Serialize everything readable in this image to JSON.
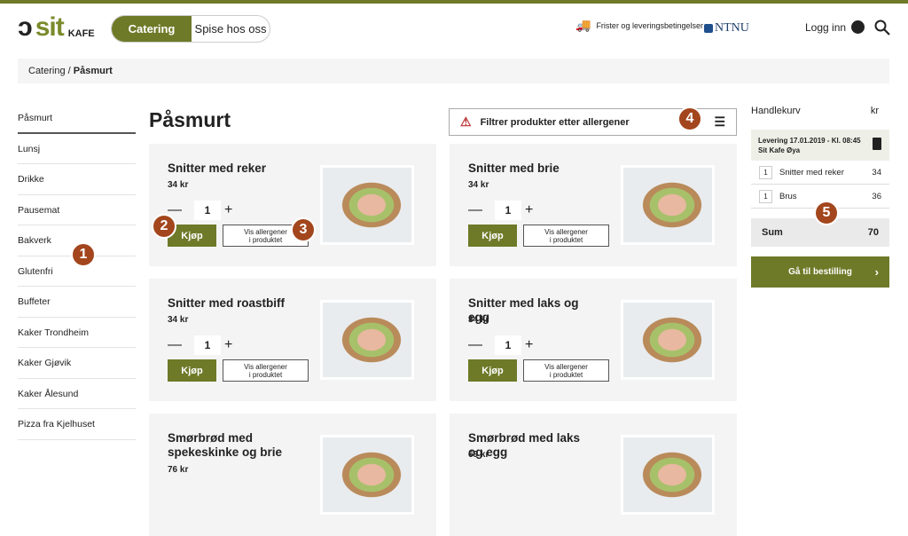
{
  "brand": {
    "logo_text": "sit",
    "logo_sub": "KAFE",
    "accent": "#6e7a28",
    "marker_color": "#a3461d"
  },
  "nav": {
    "tabs": [
      {
        "label": "Catering",
        "active": true
      },
      {
        "label": "Spise hos oss",
        "active": false
      }
    ],
    "delivery_link": "Frister og leveringsbetingelser",
    "ntnu": "NTNU",
    "login": "Logg inn"
  },
  "breadcrumb": {
    "parent": "Catering",
    "sep": " / ",
    "current": "Påsmurt"
  },
  "sidebar": {
    "items": [
      "Påsmurt",
      "Lunsj",
      "Drikke",
      "Pausemat",
      "Bakverk",
      "Glutenfri",
      "Buffeter",
      "Kaker Trondheim",
      "Kaker Gjøvik",
      "Kaker Ålesund",
      "Pizza fra Kjelhuset"
    ],
    "active": "Påsmurt"
  },
  "main": {
    "title": "Påsmurt",
    "filter_label": "Filtrer produkter etter allergener",
    "buy_label": "Kjøp",
    "allergen_label_1": "Vis allergener",
    "allergen_label_2": "i produktet",
    "products": [
      {
        "name": "Snitter med reker",
        "price": "34 kr",
        "qty": "1"
      },
      {
        "name": "Snitter med brie",
        "price": "34 kr",
        "qty": "1"
      },
      {
        "name": "Snitter med roastbiff",
        "price": "34 kr",
        "qty": "1"
      },
      {
        "name": "Snitter med laks og egg",
        "price": "34 kr",
        "qty": "1"
      },
      {
        "name": "Smørbrød med spekeskinke og brie",
        "price": "76 kr"
      },
      {
        "name": "Smørbrød med laks og egg",
        "price": "69 kr"
      }
    ]
  },
  "cart": {
    "title": "Handlekurv",
    "currency": "kr",
    "delivery_line1": "Levering 17.01.2019 - Kl. 08:45",
    "delivery_line2": "Sit Kafe Øya",
    "items": [
      {
        "qty": "1",
        "name": "Snitter med reker",
        "price": "34"
      },
      {
        "qty": "1",
        "name": "Brus",
        "price": "36"
      }
    ],
    "sum_label": "Sum",
    "sum": "70",
    "checkout": "Gå til bestilling"
  },
  "markers": [
    "1",
    "2",
    "3",
    "4",
    "5"
  ]
}
